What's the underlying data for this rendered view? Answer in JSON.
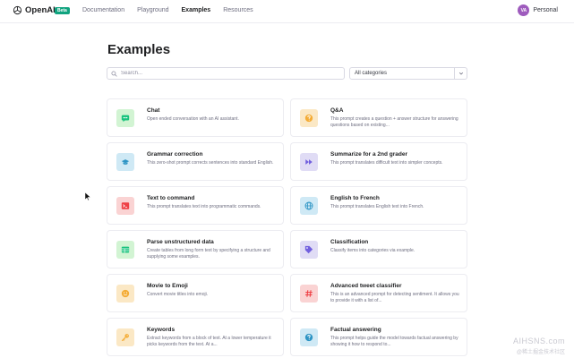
{
  "nav": {
    "brand": "OpenAI",
    "beta_badge": "Beta",
    "links": [
      "Documentation",
      "Playground",
      "Examples",
      "Resources"
    ],
    "active_link": "Examples",
    "user": {
      "initials": "VA",
      "name": "Personal"
    }
  },
  "page": {
    "title": "Examples",
    "search_placeholder": "Search...",
    "category_value": "All categories"
  },
  "examples": [
    {
      "title": "Chat",
      "desc": "Open ended conversation with an AI assistant.",
      "icon": "chat-bubble-icon",
      "bg": "#d2f4d3",
      "fg": "#19c37d"
    },
    {
      "title": "Q&A",
      "desc": "This prompt creates a question + answer structure for answering questions based on existing...",
      "icon": "question-icon",
      "bg": "#fbe8c5",
      "fg": "#f4ac36"
    },
    {
      "title": "Grammar correction",
      "desc": "This zero-shot prompt corrects sentences into standard English.",
      "icon": "graduation-cap-icon",
      "bg": "#cfe9f5",
      "fg": "#2d94c4"
    },
    {
      "title": "Summarize for a 2nd grader",
      "desc": "This prompt translates difficult text into simpler concepts.",
      "icon": "fast-forward-icon",
      "bg": "#e0dcf5",
      "fg": "#715fde"
    },
    {
      "title": "Text to command",
      "desc": "This prompt translates text into programmatic commands.",
      "icon": "terminal-icon",
      "bg": "#fad3d3",
      "fg": "#ef4146"
    },
    {
      "title": "English to French",
      "desc": "This prompt translates English text into French.",
      "icon": "globe-icon",
      "bg": "#cfe9f5",
      "fg": "#2d94c4"
    },
    {
      "title": "Parse unstructured data",
      "desc": "Create tables from long form text by specifying a structure and supplying some examples.",
      "icon": "table-icon",
      "bg": "#d2f4d3",
      "fg": "#19c37d"
    },
    {
      "title": "Classification",
      "desc": "Classify items into categories via example.",
      "icon": "tag-icon",
      "bg": "#e0dcf5",
      "fg": "#715fde"
    },
    {
      "title": "Movie to Emoji",
      "desc": "Convert movie titles into emoji.",
      "icon": "smile-icon",
      "bg": "#fbe8c5",
      "fg": "#f4ac36"
    },
    {
      "title": "Advanced tweet classifier",
      "desc": "This is an advanced prompt for detecting sentiment. It allows you to provide it with a list of...",
      "icon": "hashtag-icon",
      "bg": "#fad3d3",
      "fg": "#ef4146"
    },
    {
      "title": "Keywords",
      "desc": "Extract keywords from a block of text. At a lower temperature it picks keywords from the text. At a...",
      "icon": "key-icon",
      "bg": "#fbe8c5",
      "fg": "#f4ac36"
    },
    {
      "title": "Factual answering",
      "desc": "This prompt helps guide the model towards factual answering by showing it how to respond to...",
      "icon": "question-circle-icon",
      "bg": "#cfe9f5",
      "fg": "#2d94c4"
    }
  ],
  "watermark": {
    "line1": "AIHSNS.com",
    "line2": "@稀土掘金技术社区"
  }
}
